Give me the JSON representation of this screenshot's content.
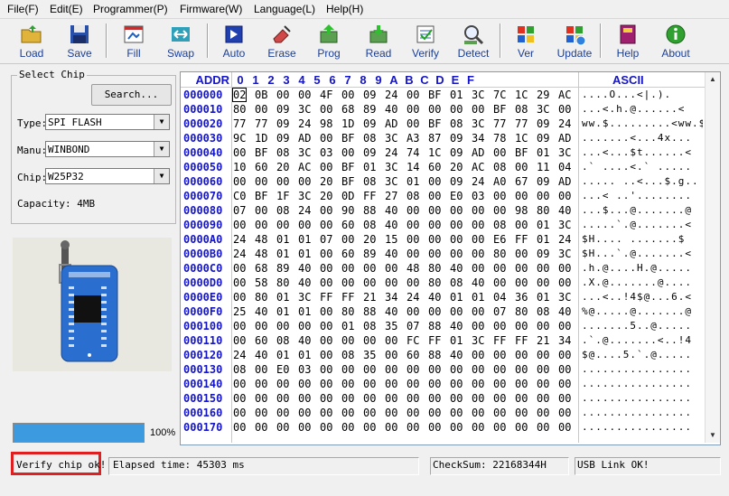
{
  "menu": [
    "File(F)",
    "Edit(E)",
    "Programmer(P)",
    "Firmware(W)",
    "Language(L)",
    "Help(H)"
  ],
  "toolbar": [
    {
      "label": "Load",
      "icon": "folder-icon"
    },
    {
      "label": "Save",
      "icon": "floppy-icon"
    },
    {
      "label": "Fill",
      "icon": "fill-icon"
    },
    {
      "label": "Swap",
      "icon": "swap-icon"
    },
    {
      "label": "Auto",
      "icon": "auto-icon"
    },
    {
      "label": "Erase",
      "icon": "eraser-icon"
    },
    {
      "label": "Prog",
      "icon": "program-icon"
    },
    {
      "label": "Read",
      "icon": "read-icon"
    },
    {
      "label": "Verify",
      "icon": "verify-icon"
    },
    {
      "label": "Detect",
      "icon": "detect-icon"
    },
    {
      "label": "Ver",
      "icon": "windows-flag-icon"
    },
    {
      "label": "Update",
      "icon": "windows-update-icon"
    },
    {
      "label": "Help",
      "icon": "book-icon"
    },
    {
      "label": "About",
      "icon": "info-icon"
    }
  ],
  "select_chip": {
    "title": "Select Chip",
    "search_label": "Search...",
    "type_label": "Type:",
    "type_value": "SPI FLASH",
    "manu_label": "Manu:",
    "manu_value": "WINBOND",
    "chip_label": "Chip:",
    "chip_value": "W25P32",
    "capacity": "Capacity: 4MB"
  },
  "progress": {
    "value": 1.0,
    "label": "100%"
  },
  "hex": {
    "addr_header": "ADDR",
    "col_headers": [
      "0",
      "1",
      "2",
      "3",
      "4",
      "5",
      "6",
      "7",
      "8",
      "9",
      "A",
      "B",
      "C",
      "D",
      "E",
      "F"
    ],
    "ascii_header": "ASCII",
    "rows": [
      {
        "addr": "000000",
        "bytes": [
          "02",
          "0B",
          "00",
          "00",
          "4F",
          "00",
          "09",
          "24",
          "00",
          "BF",
          "01",
          "3C",
          "7C",
          "1C",
          "29",
          "AC"
        ],
        "ascii": "....O...<|.)."
      },
      {
        "addr": "000010",
        "bytes": [
          "80",
          "00",
          "09",
          "3C",
          "00",
          "68",
          "89",
          "40",
          "00",
          "00",
          "00",
          "00",
          "BF",
          "08",
          "3C",
          "00"
        ],
        "ascii": "...<.h.@......<"
      },
      {
        "addr": "000020",
        "bytes": [
          "77",
          "77",
          "09",
          "24",
          "98",
          "1D",
          "09",
          "AD",
          "00",
          "BF",
          "08",
          "3C",
          "77",
          "77",
          "09",
          "24"
        ],
        "ascii": "ww.$.........<ww.$"
      },
      {
        "addr": "000030",
        "bytes": [
          "9C",
          "1D",
          "09",
          "AD",
          "00",
          "BF",
          "08",
          "3C",
          "A3",
          "87",
          "09",
          "34",
          "78",
          "1C",
          "09",
          "AD"
        ],
        "ascii": ".......<...4x..."
      },
      {
        "addr": "000040",
        "bytes": [
          "00",
          "BF",
          "08",
          "3C",
          "03",
          "00",
          "09",
          "24",
          "74",
          "1C",
          "09",
          "AD",
          "00",
          "BF",
          "01",
          "3C"
        ],
        "ascii": "...<...$t......<"
      },
      {
        "addr": "000050",
        "bytes": [
          "10",
          "60",
          "20",
          "AC",
          "00",
          "BF",
          "01",
          "3C",
          "14",
          "60",
          "20",
          "AC",
          "08",
          "00",
          "11",
          "04"
        ],
        "ascii": ".` ....<.` ....."
      },
      {
        "addr": "000060",
        "bytes": [
          "00",
          "00",
          "00",
          "00",
          "20",
          "BF",
          "08",
          "3C",
          "01",
          "00",
          "09",
          "24",
          "A0",
          "67",
          "09",
          "AD"
        ],
        "ascii": "..... ..<...$.g.."
      },
      {
        "addr": "000070",
        "bytes": [
          "C0",
          "BF",
          "1F",
          "3C",
          "20",
          "0D",
          "FF",
          "27",
          "08",
          "00",
          "E0",
          "03",
          "00",
          "00",
          "00",
          "00"
        ],
        "ascii": "...< ..'........"
      },
      {
        "addr": "000080",
        "bytes": [
          "07",
          "00",
          "08",
          "24",
          "00",
          "90",
          "88",
          "40",
          "00",
          "00",
          "00",
          "00",
          "00",
          "98",
          "80",
          "40"
        ],
        "ascii": "...$...@.......@"
      },
      {
        "addr": "000090",
        "bytes": [
          "00",
          "00",
          "00",
          "00",
          "00",
          "60",
          "08",
          "40",
          "00",
          "00",
          "00",
          "00",
          "08",
          "00",
          "01",
          "3C"
        ],
        "ascii": ".....`.@.......<"
      },
      {
        "addr": "0000A0",
        "bytes": [
          "24",
          "48",
          "01",
          "01",
          "07",
          "00",
          "20",
          "15",
          "00",
          "00",
          "00",
          "00",
          "E6",
          "FF",
          "01",
          "24"
        ],
        "ascii": "$H.... .......$"
      },
      {
        "addr": "0000B0",
        "bytes": [
          "24",
          "48",
          "01",
          "01",
          "00",
          "60",
          "89",
          "40",
          "00",
          "00",
          "00",
          "00",
          "80",
          "00",
          "09",
          "3C"
        ],
        "ascii": "$H...`.@.......<"
      },
      {
        "addr": "0000C0",
        "bytes": [
          "00",
          "68",
          "89",
          "40",
          "00",
          "00",
          "00",
          "00",
          "48",
          "80",
          "40",
          "00",
          "00",
          "00",
          "00",
          "00"
        ],
        "ascii": ".h.@....H.@....."
      },
      {
        "addr": "0000D0",
        "bytes": [
          "00",
          "58",
          "80",
          "40",
          "00",
          "00",
          "00",
          "00",
          "00",
          "80",
          "08",
          "40",
          "00",
          "00",
          "00",
          "00"
        ],
        "ascii": ".X.@.......@...."
      },
      {
        "addr": "0000E0",
        "bytes": [
          "00",
          "80",
          "01",
          "3C",
          "FF",
          "FF",
          "21",
          "34",
          "24",
          "40",
          "01",
          "01",
          "04",
          "36",
          "01",
          "3C"
        ],
        "ascii": "...<..!4$@...6.<"
      },
      {
        "addr": "0000F0",
        "bytes": [
          "25",
          "40",
          "01",
          "01",
          "00",
          "80",
          "88",
          "40",
          "00",
          "00",
          "00",
          "00",
          "07",
          "80",
          "08",
          "40"
        ],
        "ascii": "%@.....@.......@"
      },
      {
        "addr": "000100",
        "bytes": [
          "00",
          "00",
          "00",
          "00",
          "00",
          "01",
          "08",
          "35",
          "07",
          "88",
          "40",
          "00",
          "00",
          "00",
          "00",
          "00"
        ],
        "ascii": ".......5..@....."
      },
      {
        "addr": "000110",
        "bytes": [
          "00",
          "60",
          "08",
          "40",
          "00",
          "00",
          "00",
          "00",
          "FC",
          "FF",
          "01",
          "3C",
          "FF",
          "FF",
          "21",
          "34"
        ],
        "ascii": ".`.@.......<..!4"
      },
      {
        "addr": "000120",
        "bytes": [
          "24",
          "40",
          "01",
          "01",
          "00",
          "08",
          "35",
          "00",
          "60",
          "88",
          "40",
          "00",
          "00",
          "00",
          "00",
          "00"
        ],
        "ascii": "$@....5.`.@....."
      },
      {
        "addr": "000130",
        "bytes": [
          "08",
          "00",
          "E0",
          "03",
          "00",
          "00",
          "00",
          "00",
          "00",
          "00",
          "00",
          "00",
          "00",
          "00",
          "00",
          "00"
        ],
        "ascii": "................"
      },
      {
        "addr": "000140",
        "bytes": [
          "00",
          "00",
          "00",
          "00",
          "00",
          "00",
          "00",
          "00",
          "00",
          "00",
          "00",
          "00",
          "00",
          "00",
          "00",
          "00"
        ],
        "ascii": "................"
      },
      {
        "addr": "000150",
        "bytes": [
          "00",
          "00",
          "00",
          "00",
          "00",
          "00",
          "00",
          "00",
          "00",
          "00",
          "00",
          "00",
          "00",
          "00",
          "00",
          "00"
        ],
        "ascii": "................"
      },
      {
        "addr": "000160",
        "bytes": [
          "00",
          "00",
          "00",
          "00",
          "00",
          "00",
          "00",
          "00",
          "00",
          "00",
          "00",
          "00",
          "00",
          "00",
          "00",
          "00"
        ],
        "ascii": "................"
      },
      {
        "addr": "000170",
        "bytes": [
          "00",
          "00",
          "00",
          "00",
          "00",
          "00",
          "00",
          "00",
          "00",
          "00",
          "00",
          "00",
          "00",
          "00",
          "00",
          "00"
        ],
        "ascii": "................"
      }
    ]
  },
  "status": {
    "message": "Verify chip ok!",
    "elapsed": "Elapsed time: 45303 ms",
    "checksum": "CheckSum: 22168344H",
    "usb": "USB Link OK!"
  },
  "colors": {
    "highlight_red": "#e02020",
    "address_blue": "#1515c8",
    "progress_blue": "#3c9be0"
  }
}
